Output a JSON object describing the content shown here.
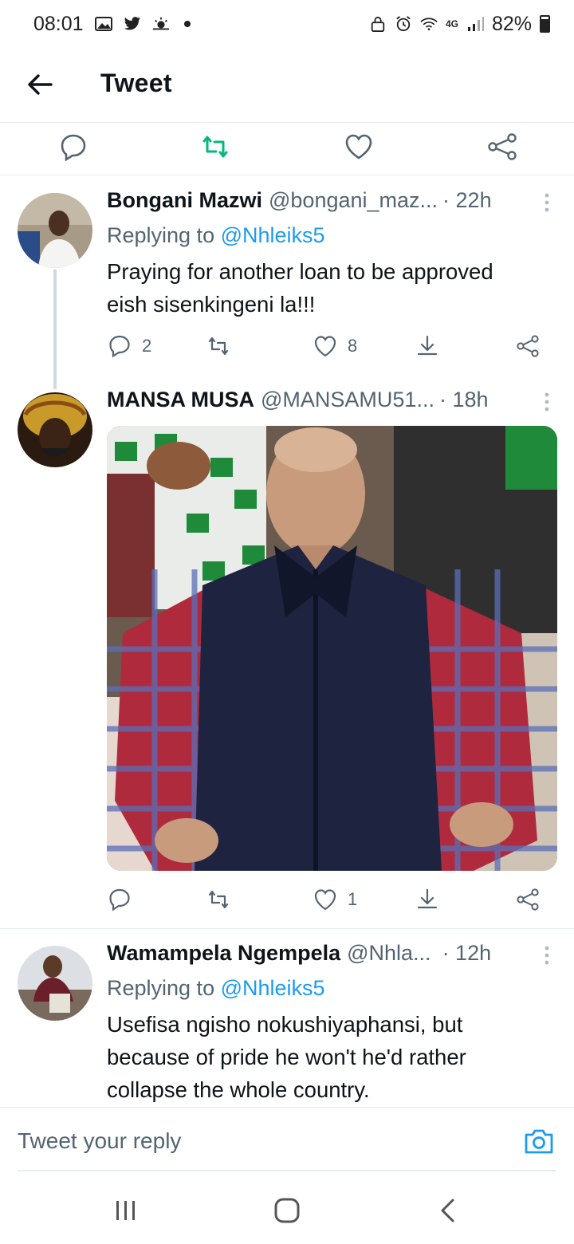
{
  "status_bar": {
    "time": "08:01",
    "battery": "82%",
    "network": "4G"
  },
  "header": {
    "title": "Tweet"
  },
  "tweets": [
    {
      "name": "Bongani Mazwi",
      "handle": "@bongani_maz...",
      "time": "· 22h",
      "replying_label": "Replying to",
      "replying_to": "@Nhleiks5",
      "text_lines": [
        "Praying for another loan to be approved",
        "eish sisenkingeni la!!!"
      ],
      "reply_count": "2",
      "retweet_count": "",
      "like_count": "8"
    },
    {
      "name": "MANSA MUSA",
      "handle": "@MANSAMU51...",
      "time": "· 18h",
      "reply_count": "",
      "retweet_count": "",
      "like_count": "1"
    },
    {
      "name": "Wamampela Ngempela",
      "handle": "@Nhla...",
      "time": "· 12h",
      "replying_label": "Replying to",
      "replying_to": "@Nhleiks5",
      "text_lines": [
        "Usefisa ngisho nokushiyaphansi, but",
        "because of pride he won't he'd rather",
        "collapse the whole country."
      ]
    }
  ],
  "reply_bar": {
    "placeholder": "Tweet your reply"
  },
  "colors": {
    "accent": "#1d9bf0",
    "retweet_green": "#00ba7c",
    "muted": "#536471"
  }
}
